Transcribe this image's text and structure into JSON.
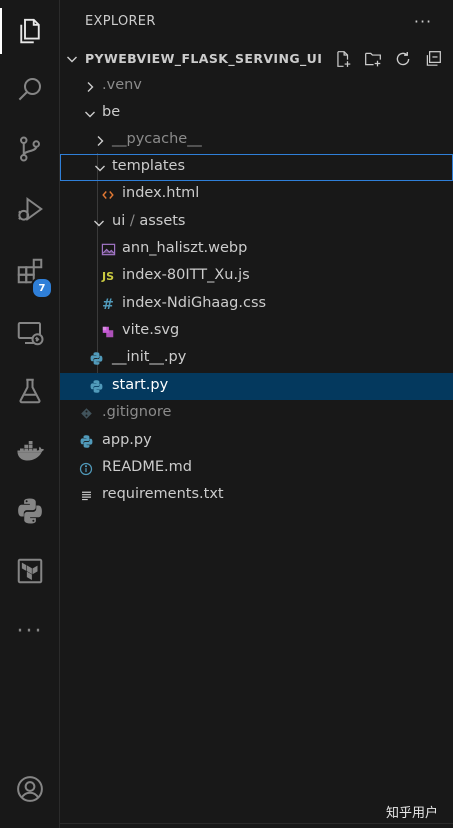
{
  "explorer": {
    "title": "EXPLORER",
    "more_label": "···",
    "project": "PYWEBVIEW_FLASK_SERVING_UI",
    "tree": [
      {
        "name": ".venv",
        "type": "folder",
        "expanded": false,
        "dim": true
      },
      {
        "name": "be",
        "type": "folder",
        "expanded": true
      },
      {
        "name": "__pycache__",
        "type": "folder",
        "expanded": false,
        "dim": true
      },
      {
        "name": "templates",
        "type": "folder",
        "expanded": true,
        "focused": true
      },
      {
        "name": "index.html",
        "type": "file",
        "icon": "html-icon"
      },
      {
        "name": "ui",
        "type": "folder",
        "expanded": true
      },
      {
        "name": "assets",
        "type": "folder"
      },
      {
        "name": "ann_haliszt.webp",
        "type": "file",
        "icon": "image-icon"
      },
      {
        "name": "index-80ITT_Xu.js",
        "type": "file",
        "icon": "js-icon"
      },
      {
        "name": "index-NdiGhaag.css",
        "type": "file",
        "icon": "css-icon"
      },
      {
        "name": "vite.svg",
        "type": "file",
        "icon": "svg-icon"
      },
      {
        "name": "__init__.py",
        "type": "file",
        "icon": "python-icon"
      },
      {
        "name": "start.py",
        "type": "file",
        "icon": "python-icon",
        "selected": true
      },
      {
        "name": ".gitignore",
        "type": "file",
        "icon": "git-icon"
      },
      {
        "name": "app.py",
        "type": "file",
        "icon": "python-icon"
      },
      {
        "name": "README.md",
        "type": "file",
        "icon": "info-icon"
      },
      {
        "name": "requirements.txt",
        "type": "file",
        "icon": "text-lines-icon"
      }
    ]
  },
  "activity_bar": {
    "items": [
      "files-icon",
      "search-icon",
      "source-control-icon",
      "run-debug-icon",
      "extensions-icon",
      "remote-explorer-icon",
      "testing-flask-icon",
      "docker-icon",
      "python-icon",
      "terraform-icon",
      "more-icon",
      "account-icon"
    ],
    "extensions_badge": "7",
    "more_label": "···"
  },
  "icon_glyphs": {
    "js": "JS",
    "css": "#",
    "ui_separator": "/"
  },
  "watermark": "知乎用户",
  "colors": {
    "background": "#181818",
    "selected_row": "#04395e",
    "focus_border": "#2f7fd8",
    "badge": "#2f7fd8",
    "html_icon": "#e37933",
    "js_icon": "#cbcb41",
    "css_icon": "#519aba",
    "image_icon": "#a074c4",
    "svg_icon": "#c75ad5",
    "python_icon": "#519aba"
  }
}
